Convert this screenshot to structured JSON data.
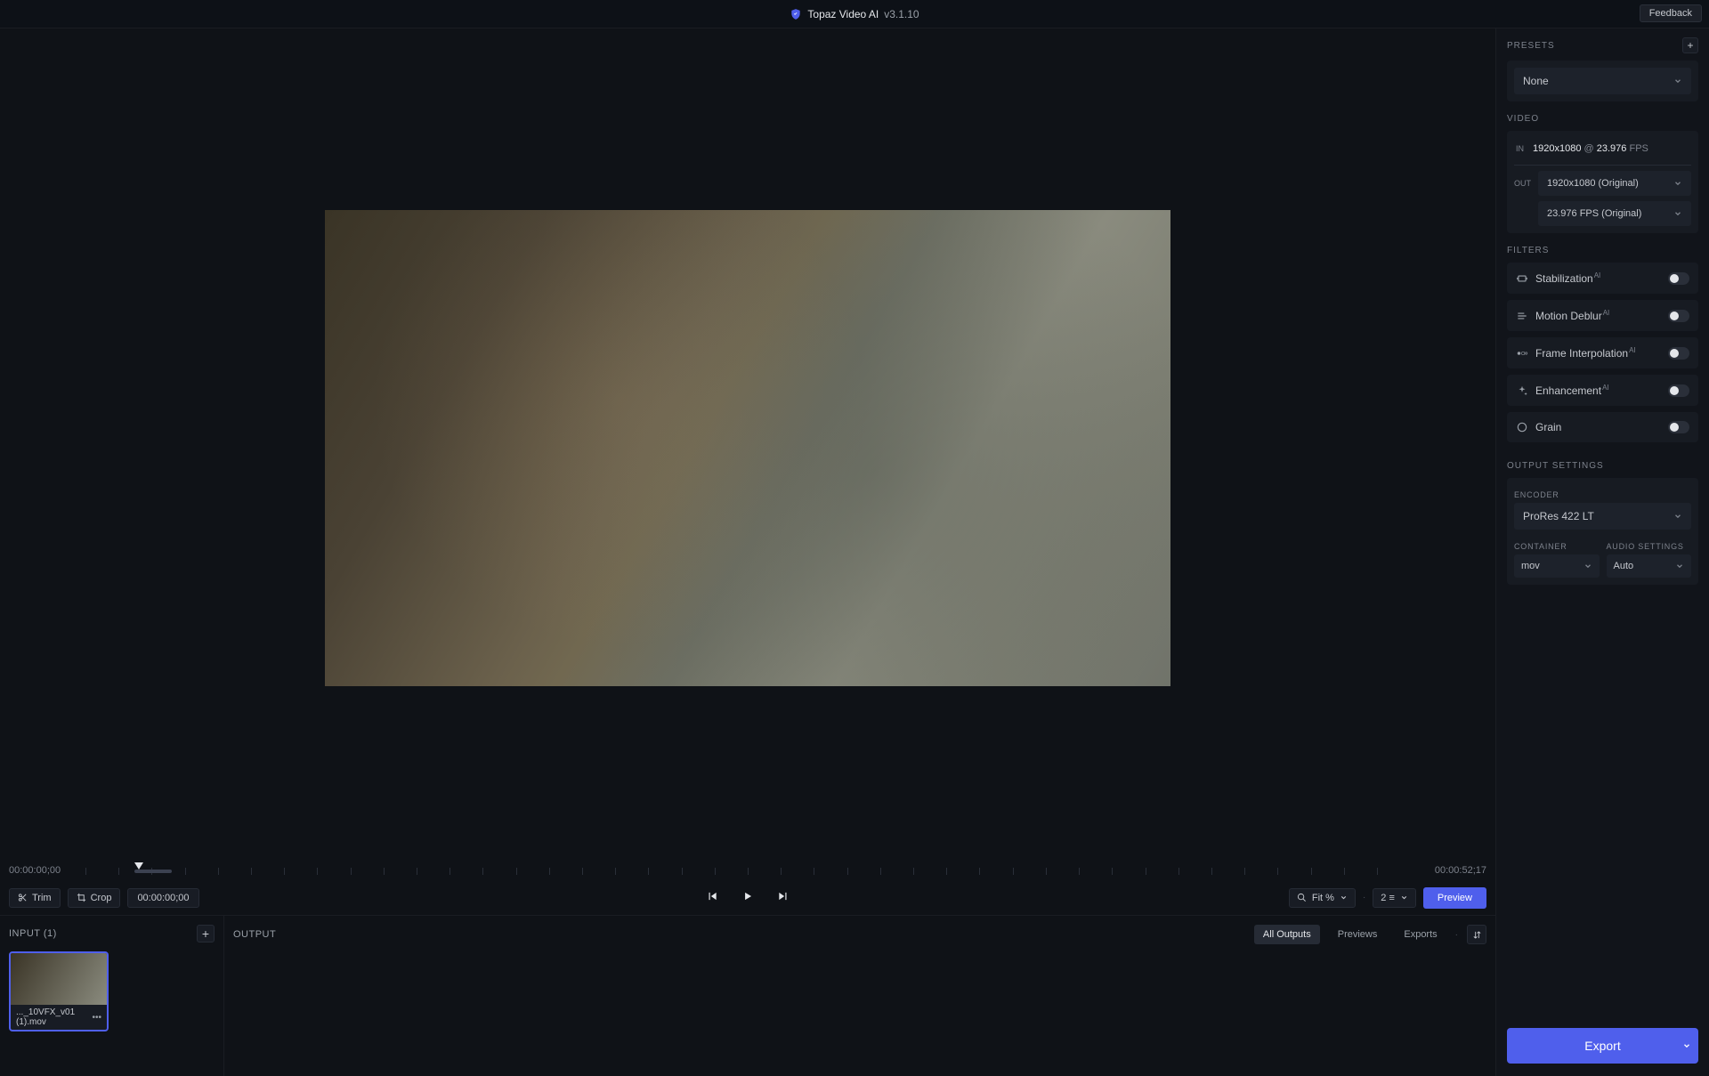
{
  "title": {
    "app": "Topaz Video AI",
    "version": "v3.1.10",
    "feedback": "Feedback"
  },
  "timeline": {
    "start": "00:00:00;00",
    "end": "00:00:52;17",
    "current": "00:00:00;00"
  },
  "controls": {
    "trim": "Trim",
    "crop": "Crop",
    "fit": "Fit %",
    "split": "2 ≡",
    "preview": "Preview"
  },
  "input": {
    "heading": "INPUT (1)",
    "file": "..._10VFX_v01 (1).mov"
  },
  "output": {
    "heading": "OUTPUT",
    "tabs": {
      "all": "All Outputs",
      "previews": "Previews",
      "exports": "Exports"
    }
  },
  "sidebar": {
    "presets": {
      "label": "PRESETS",
      "value": "None"
    },
    "video": {
      "label": "VIDEO",
      "in_badge": "IN",
      "in_res": "1920x1080",
      "in_at": "@",
      "in_fps": "23.976",
      "in_fps_unit": "FPS",
      "out_badge": "OUT",
      "out_res": "1920x1080 (Original)",
      "out_fps": "23.976 FPS (Original)"
    },
    "filters": {
      "label": "FILTERS",
      "stabilization": "Stabilization",
      "motion_deblur": "Motion Deblur",
      "frame_interp": "Frame Interpolation",
      "enhancement": "Enhancement",
      "grain": "Grain"
    },
    "output_settings": {
      "label": "OUTPUT SETTINGS",
      "encoder_lbl": "ENCODER",
      "encoder": "ProRes 422 LT",
      "container_lbl": "CONTAINER",
      "container": "mov",
      "audio_lbl": "AUDIO SETTINGS",
      "audio": "Auto"
    },
    "export": "Export"
  }
}
